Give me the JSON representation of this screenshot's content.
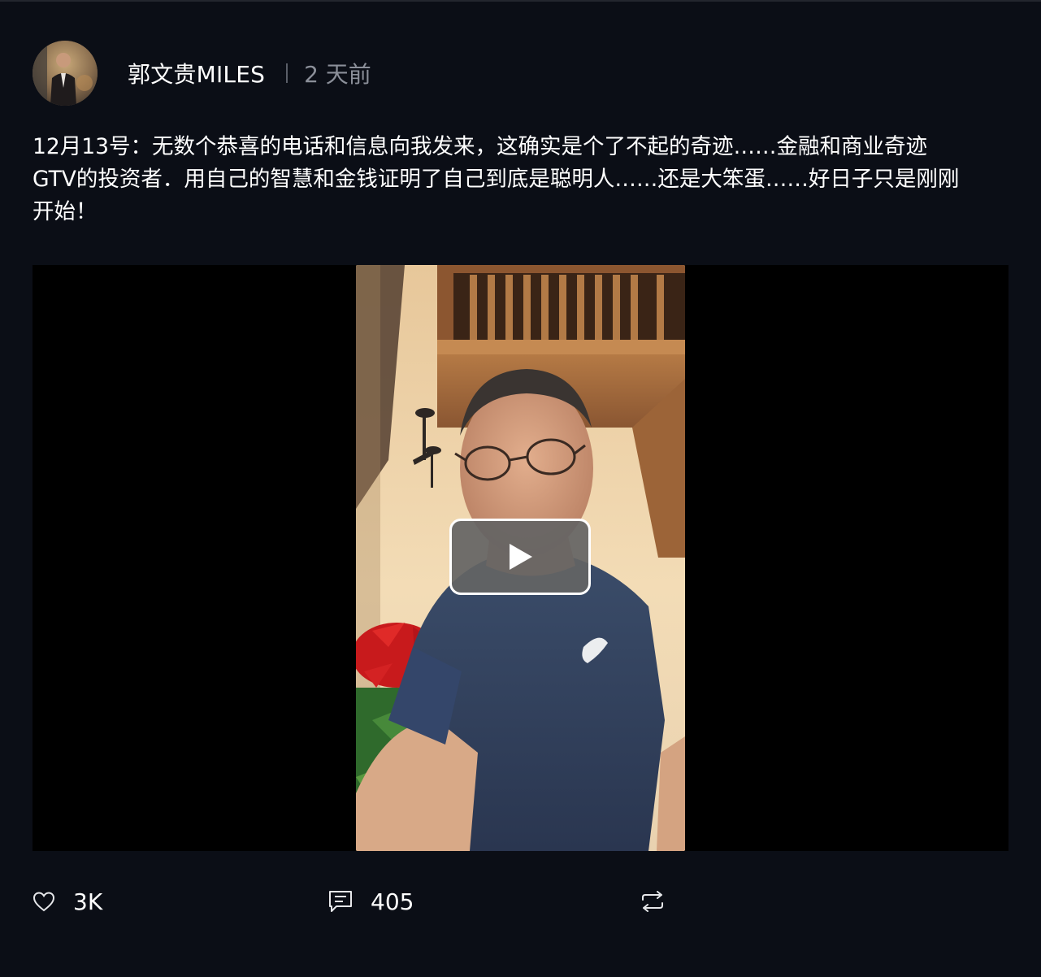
{
  "post": {
    "author": "郭文贵MILES",
    "time": "2 天前",
    "text": "12月13号：无数个恭喜的电话和信息向我发来，这确实是个了不起的奇迹……金融和商业奇迹\nGTV的投资者．用自己的智慧和金钱证明了自己到底是聪明人……还是大笨蛋……好日子只是刚刚\n开始！"
  },
  "video": {
    "play_icon": "play-icon"
  },
  "actions": {
    "likes": "3K",
    "comments": "405",
    "like_icon": "heart-icon",
    "comment_icon": "comment-icon",
    "repost_icon": "repost-icon"
  },
  "colors": {
    "background": "#0b0e16",
    "text": "#ffffff",
    "muted": "#8b8f99"
  }
}
